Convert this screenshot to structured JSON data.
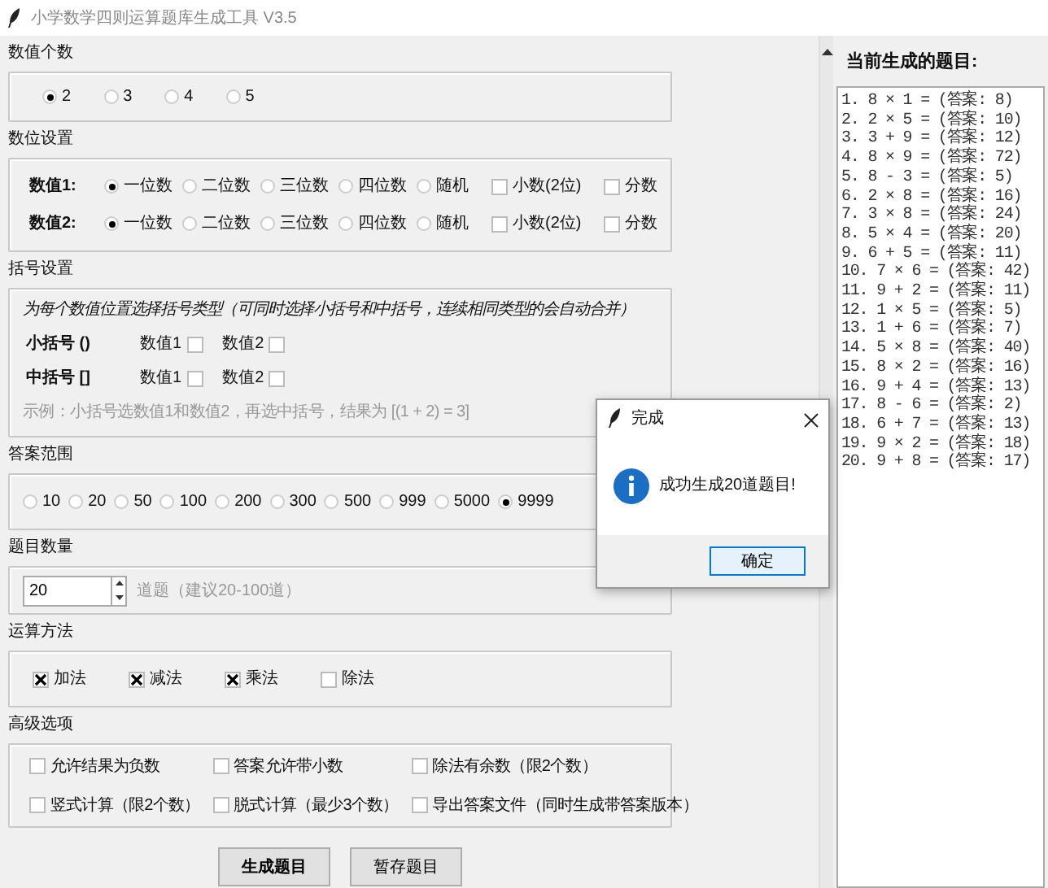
{
  "window": {
    "title": "小学数学四则运算题库生成工具  V3.5"
  },
  "value_count": {
    "label": "数值个数",
    "options": [
      {
        "label": "2",
        "selected": true
      },
      {
        "label": "3",
        "selected": false
      },
      {
        "label": "4",
        "selected": false
      },
      {
        "label": "5",
        "selected": false
      }
    ]
  },
  "digits": {
    "label": "数位设置",
    "rows": [
      {
        "label": "数值1:",
        "radios": [
          {
            "label": "一位数",
            "selected": true
          },
          {
            "label": "二位数",
            "selected": false
          },
          {
            "label": "三位数",
            "selected": false
          },
          {
            "label": "四位数",
            "selected": false
          },
          {
            "label": "随机",
            "selected": false
          }
        ],
        "checks": [
          {
            "label": "小数(2位)",
            "checked": false
          },
          {
            "label": "分数",
            "checked": false
          }
        ]
      },
      {
        "label": "数值2:",
        "radios": [
          {
            "label": "一位数",
            "selected": true
          },
          {
            "label": "二位数",
            "selected": false
          },
          {
            "label": "三位数",
            "selected": false
          },
          {
            "label": "四位数",
            "selected": false
          },
          {
            "label": "随机",
            "selected": false
          }
        ],
        "checks": [
          {
            "label": "小数(2位)",
            "checked": false
          },
          {
            "label": "分数",
            "checked": false
          }
        ]
      }
    ]
  },
  "brackets": {
    "label": "括号设置",
    "hint": "为每个数值位置选择括号类型（可同时选择小括号和中括号，连续相同类型的会自动合并）",
    "rows": [
      {
        "label": "小括号 ()",
        "options": [
          {
            "label": "数值1",
            "checked": false
          },
          {
            "label": "数值2",
            "checked": false
          }
        ]
      },
      {
        "label": "中括号 []",
        "options": [
          {
            "label": "数值1",
            "checked": false
          },
          {
            "label": "数值2",
            "checked": false
          }
        ]
      }
    ],
    "example": "示例：小括号选数值1和数值2，再选中括号，结果为 [(1 + 2) = 3]"
  },
  "answer_range": {
    "label": "答案范围",
    "options": [
      {
        "label": "10",
        "selected": false
      },
      {
        "label": "20",
        "selected": false
      },
      {
        "label": "50",
        "selected": false
      },
      {
        "label": "100",
        "selected": false
      },
      {
        "label": "200",
        "selected": false
      },
      {
        "label": "300",
        "selected": false
      },
      {
        "label": "500",
        "selected": false
      },
      {
        "label": "999",
        "selected": false
      },
      {
        "label": "5000",
        "selected": false
      },
      {
        "label": "9999",
        "selected": true
      }
    ]
  },
  "question_count": {
    "label": "题目数量",
    "value": "20",
    "hint": "道题（建议20-100道）"
  },
  "operations": {
    "label": "运算方法",
    "options": [
      {
        "label": "加法",
        "checked": true
      },
      {
        "label": "减法",
        "checked": true
      },
      {
        "label": "乘法",
        "checked": true
      },
      {
        "label": "除法",
        "checked": false
      }
    ]
  },
  "advanced": {
    "label": "高级选项",
    "options": [
      {
        "label": "允许结果为负数",
        "checked": false
      },
      {
        "label": "答案允许带小数",
        "checked": false
      },
      {
        "label": "除法有余数（限2个数）",
        "checked": false
      },
      {
        "label": "竖式计算（限2个数）",
        "checked": false
      },
      {
        "label": "脱式计算（最少3个数）",
        "checked": false
      },
      {
        "label": "导出答案文件（同时生成带答案版本）",
        "checked": false
      }
    ]
  },
  "buttons": [
    {
      "label": "生成题目",
      "default": true
    },
    {
      "label": "暂存题目",
      "default": false
    }
  ],
  "output": {
    "title": "当前生成的题目:",
    "lines": [
      "1. 8 × 1 = (答案: 8)",
      "2. 2 × 5 = (答案: 10)",
      "3. 3 + 9 = (答案: 12)",
      "4. 8 × 9 = (答案: 72)",
      "5. 8 - 3 = (答案: 5)",
      "6. 2 × 8 = (答案: 16)",
      "7. 3 × 8 = (答案: 24)",
      "8. 5 × 4 = (答案: 20)",
      "9. 6 + 5 = (答案: 11)",
      "10. 7 × 6 = (答案: 42)",
      "11. 9 + 2 = (答案: 11)",
      "12. 1 × 5 = (答案: 5)",
      "13. 1 + 6 = (答案: 7)",
      "14. 5 × 8 = (答案: 40)",
      "15. 8 × 2 = (答案: 16)",
      "16. 9 + 4 = (答案: 13)",
      "17. 8 - 6 = (答案: 2)",
      "18. 6 + 7 = (答案: 13)",
      "19. 9 × 2 = (答案: 18)",
      "20. 9 + 8 = (答案: 17)"
    ]
  },
  "dialog": {
    "title": "完成",
    "message": "成功生成20道题目!",
    "button": "确定"
  }
}
